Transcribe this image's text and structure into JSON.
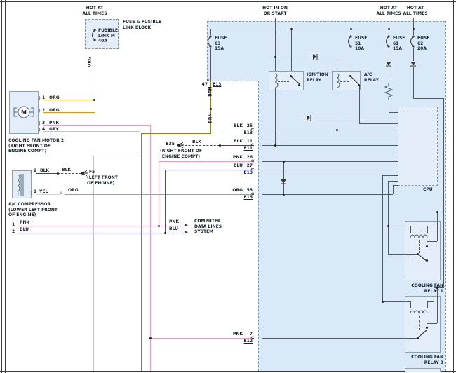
{
  "colors": {
    "org": "#ef930f",
    "pnk": "#f79ab8",
    "blu": "#3c3cf0",
    "gry": "#c3c3c3",
    "yel": "#f2e50a",
    "brn": "#9a7d14",
    "blk": "#42494f",
    "wire": "#4d5a66",
    "edge": "#7e93a8",
    "edge2": "#8ba2b5",
    "bg": "#d9e9f8",
    "cbg": "#e3eefa"
  },
  "fusible": {
    "hot": "HOT AT\nALL TIMES",
    "block": "FUSE & FUSIBLE\nLINK BLOCK",
    "link": "FUSIBLE\nLINK M\n40A",
    "wire": "ORG"
  },
  "power": {
    "hot_in_on": "HOT IN ON\nOR START",
    "hot_at_1": "HOT AT\nALL TIMES",
    "hot_at_2": "HOT AT\nALL TIMES",
    "fuse63": "FUSE\n63\n15A",
    "fuse51": "FUSE\n51\n10A",
    "fuse61": "FUSE\n61\n15A",
    "fuse62": "FUSE\n62\n20A"
  },
  "relays": {
    "ignition": "IGNITION\nRELAY",
    "ac": "A/C\nRELAY",
    "cpu": "CPU",
    "fan1": "COOLING FAN\nRELAY 1",
    "fan3": "COOLING FAN\nRELAY 3"
  },
  "motor": {
    "name": "COOLING FAN MOTOR 2\n(RIGHT FRONT OF\nENGINE COMPT)",
    "m": "M",
    "pins": [
      {
        "num": "1",
        "color": "ORG"
      },
      {
        "num": "2",
        "color": "ORG"
      },
      {
        "num": "3",
        "color": "PNK"
      },
      {
        "num": "4",
        "color": "GRY"
      }
    ]
  },
  "e35": {
    "id": "E35",
    "wire": "BLK",
    "loc": "(RIGHT FRONT OF\nENGINE COMPT)"
  },
  "compressor": {
    "name": "A/C COMPRESSOR\n(LOWER LEFT FRONT\nOF ENGINE)",
    "pin2": "2",
    "pin2_color": "BLK",
    "dash_color": "BLK",
    "ground": "F5",
    "ground_loc": "(LEFT FRONT\nOF ENGINE)",
    "pin1": "1",
    "pin1_color": "YEL",
    "splice_color": "ORG"
  },
  "data_lines": {
    "n1": "1",
    "c1": "PNK",
    "n2": "2",
    "c2": "BLU",
    "d1": "PNK",
    "d2": "BLU",
    "target": "COMPUTER\nDATA LINES\nSYSTEM"
  },
  "connectors": [
    {
      "color": "BLK",
      "pin": "25",
      "conn": "E13"
    },
    {
      "color": "BLK",
      "pin": "11",
      "conn": "E11"
    },
    {
      "color": "PNK",
      "pin": "26",
      "conn": ""
    },
    {
      "color": "BLU",
      "pin": "27",
      "conn": "E13"
    },
    {
      "color": "ORG",
      "pin": "55",
      "conn": "E15"
    },
    {
      "color": "PNK",
      "pin": "7",
      "conn": "E12"
    }
  ],
  "brn": {
    "l1": "BRN",
    "l2": "BRN",
    "pin": "47",
    "conn": "E13"
  }
}
